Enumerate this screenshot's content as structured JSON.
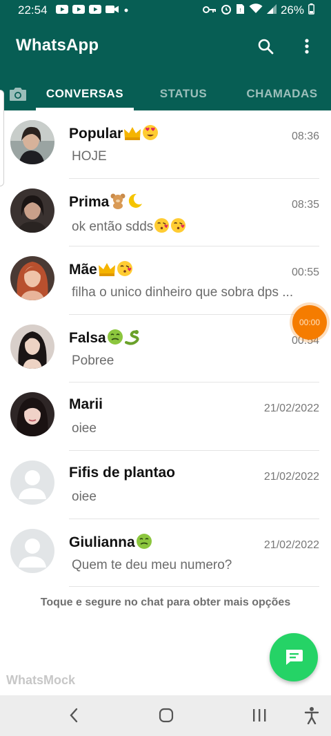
{
  "status_bar": {
    "time": "22:54",
    "battery": "26%",
    "left_icons": [
      "youtube-icon",
      "youtube-icon",
      "youtube-icon",
      "video-icon",
      "dot-icon"
    ],
    "right_icons": [
      "key-icon",
      "alarm-icon",
      "sim-icon",
      "wifi-icon",
      "signal-icon",
      "battery-icon"
    ]
  },
  "app": {
    "title": "WhatsApp",
    "colors": {
      "header": "#075e54",
      "fab": "#25d366",
      "timer": "#f57c00"
    }
  },
  "tabs": [
    {
      "label": "CONVERSAS",
      "active": true
    },
    {
      "label": "STATUS",
      "active": false
    },
    {
      "label": "CHAMADAS",
      "active": false
    }
  ],
  "chats": [
    {
      "name": "Popular",
      "emojis": [
        "crown",
        "heart-eyes"
      ],
      "time": "08:36",
      "message": "HOJE",
      "avatar": "photo"
    },
    {
      "name": "Prima",
      "emojis": [
        "teddy-bear",
        "crescent-moon"
      ],
      "time": "08:35",
      "message": "ok então sdds",
      "message_emojis": [
        "kiss-face",
        "kiss-face"
      ],
      "avatar": "photo"
    },
    {
      "name": "Mãe",
      "emojis": [
        "crown",
        "kiss-face"
      ],
      "time": "00:55",
      "message": "filha o unico dinheiro que sobra dps ...",
      "avatar": "photo"
    },
    {
      "name": "Falsa",
      "emojis": [
        "nauseated-face",
        "snake"
      ],
      "time": "00:54",
      "message": "Pobree",
      "avatar": "photo"
    },
    {
      "name": "Marii",
      "emojis": [],
      "time": "21/02/2022",
      "message": "oiee",
      "avatar": "photo"
    },
    {
      "name": "Fifis de plantao",
      "emojis": [],
      "time": "21/02/2022",
      "message": "oiee",
      "avatar": "default"
    },
    {
      "name": "Giulianna",
      "emojis": [
        "nauseated-face"
      ],
      "time": "21/02/2022",
      "message": "Quem te deu meu numero?",
      "avatar": "default"
    }
  ],
  "hint": "Toque e segure no chat para obter mais opções",
  "watermark": "WhatsMock",
  "timer_bubble": "00:00",
  "nav": [
    "back-icon",
    "home-icon",
    "recents-icon",
    "accessibility-icon"
  ]
}
